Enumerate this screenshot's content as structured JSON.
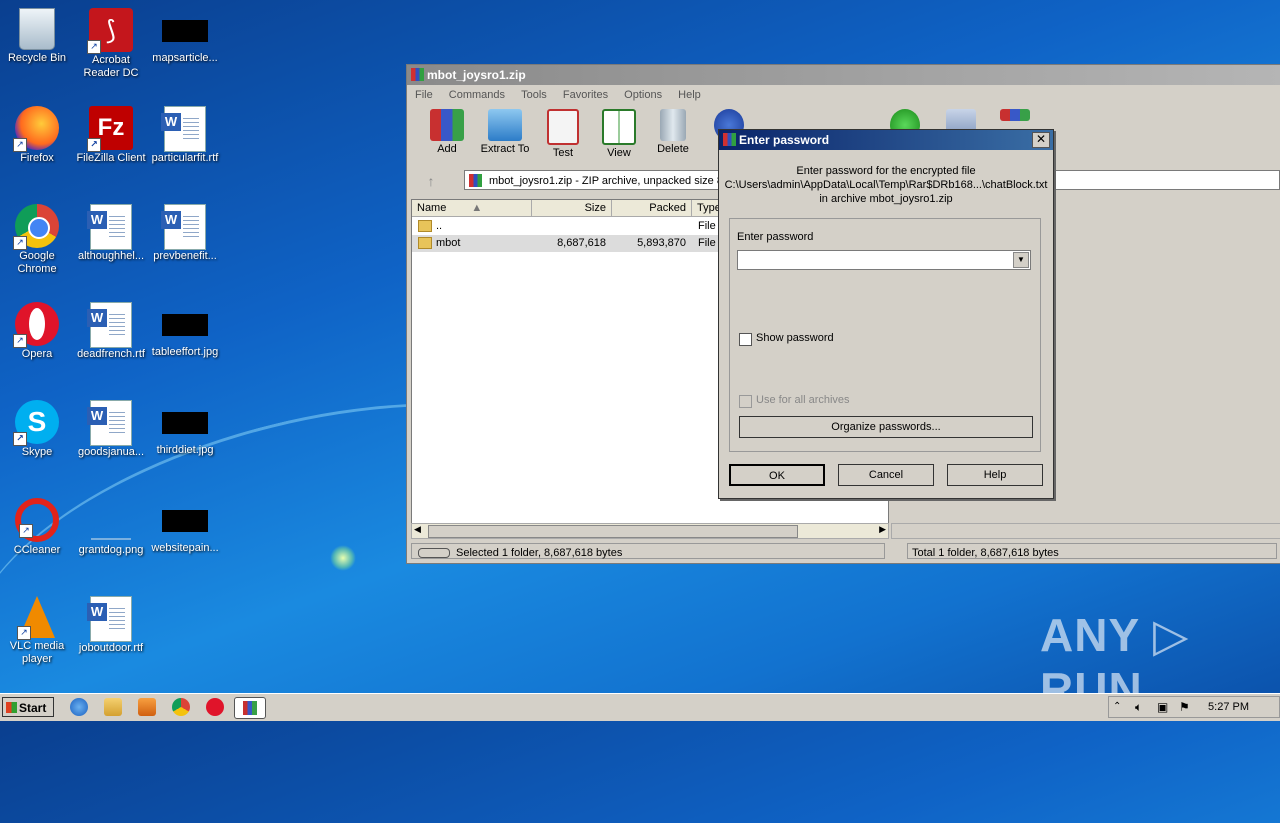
{
  "desktop": {
    "icons": [
      {
        "label": "Recycle Bin"
      },
      {
        "label": "Acrobat Reader DC"
      },
      {
        "label": "mapsarticle..."
      },
      {
        "label": "Firefox"
      },
      {
        "label": "FileZilla Client"
      },
      {
        "label": "particularfit.rtf"
      },
      {
        "label": "Google Chrome"
      },
      {
        "label": "althoughhel..."
      },
      {
        "label": "prevbenefit..."
      },
      {
        "label": "Opera"
      },
      {
        "label": "deadfrench.rtf"
      },
      {
        "label": "tableeffort.jpg"
      },
      {
        "label": "Skype"
      },
      {
        "label": "goodsjanua..."
      },
      {
        "label": "thirddiet.jpg"
      },
      {
        "label": "CCleaner"
      },
      {
        "label": "grantdog.png"
      },
      {
        "label": "websitepain..."
      },
      {
        "label": "VLC media player"
      },
      {
        "label": "joboutdoor.rtf"
      }
    ],
    "watermark": "ANY ▷ RUN"
  },
  "window": {
    "title": "mbot_joysro1.zip",
    "menu": [
      "File",
      "Commands",
      "Tools",
      "Favorites",
      "Options",
      "Help"
    ],
    "toolbar": [
      "Add",
      "Extract To",
      "Test",
      "View",
      "Delete"
    ],
    "address": "mbot_joysro1.zip - ZIP archive, unpacked size 8,687,618 bytes",
    "columns": [
      "Name",
      "Size",
      "Packed",
      "Type"
    ],
    "rows": [
      {
        "name": "..",
        "size": "",
        "packed": "",
        "type": "File f"
      },
      {
        "name": "mbot",
        "size": "8,687,618",
        "packed": "5,893,870",
        "type": "File f"
      }
    ],
    "status_left": "Selected 1 folder, 8,687,618 bytes",
    "status_right": "Total 1 folder, 8,687,618 bytes"
  },
  "dialog": {
    "title": "Enter password",
    "close": "✕",
    "msg_line1": "Enter password for the encrypted file",
    "msg_line2": "C:\\Users\\admin\\AppData\\Local\\Temp\\Rar$DRb168...\\chatBlock.txt",
    "msg_line3": "in archive mbot_joysro1.zip",
    "field_label": "Enter password",
    "password_value": "",
    "show_password": "Show password",
    "use_for_all": "Use for all archives",
    "organize": "Organize passwords...",
    "ok": "OK",
    "cancel": "Cancel",
    "help": "Help"
  },
  "taskbar": {
    "start": "Start",
    "clock": "5:27 PM"
  }
}
